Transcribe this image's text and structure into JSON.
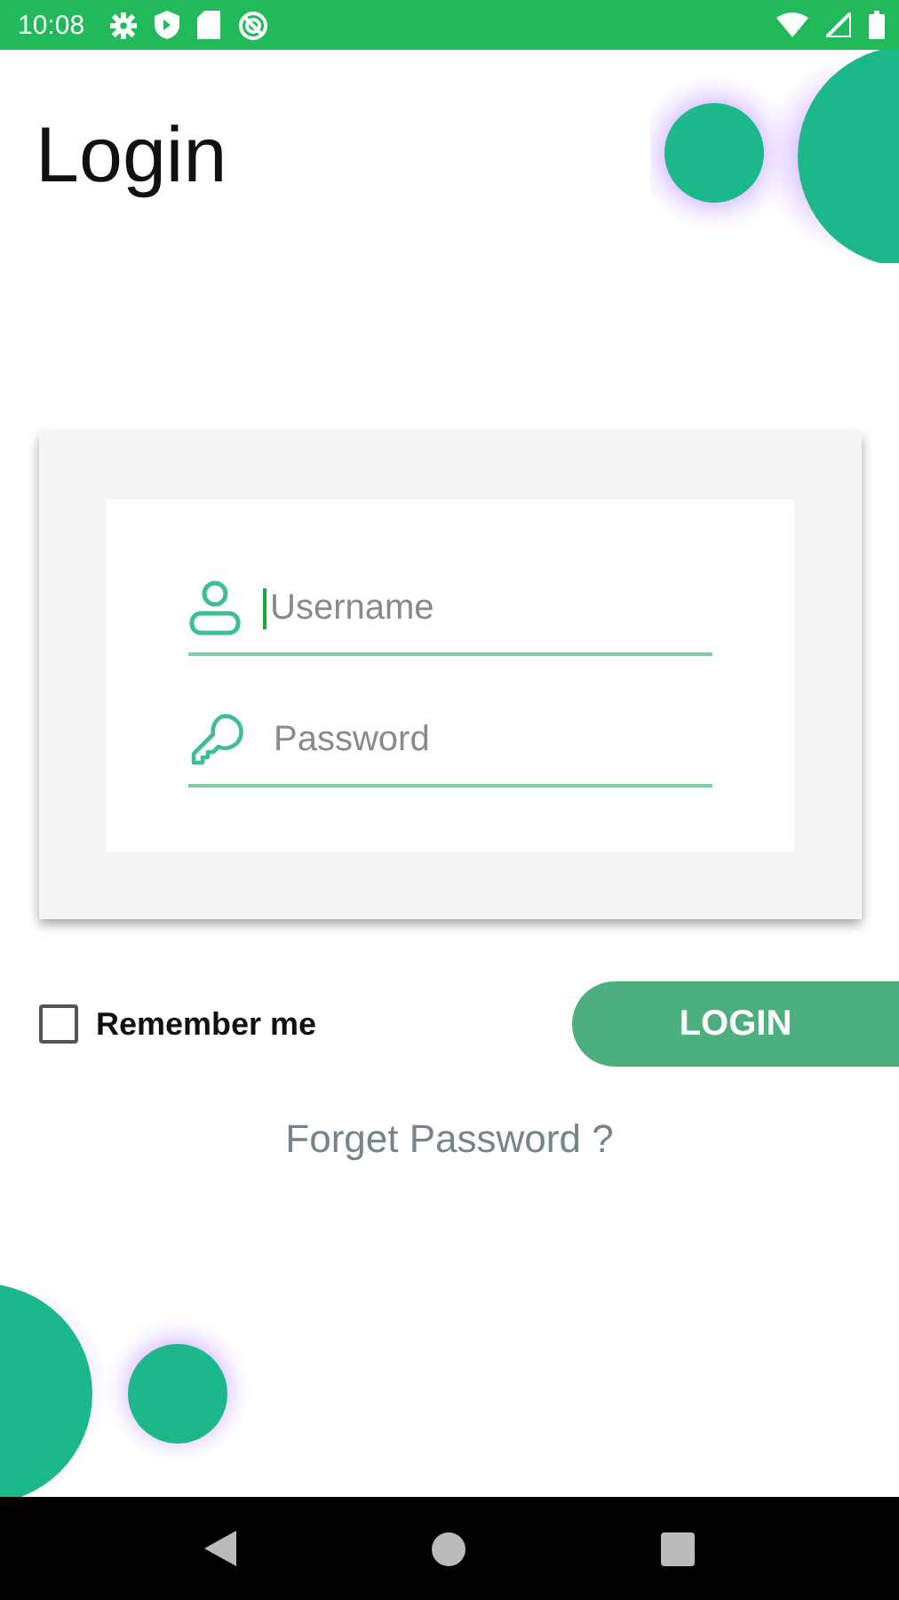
{
  "status_bar": {
    "time": "10:08"
  },
  "title": "Login",
  "fields": [
    {
      "kind": "user",
      "placeholder": "Username",
      "focused": true
    },
    {
      "kind": "key",
      "placeholder": "Password",
      "focused": false
    }
  ],
  "remember": {
    "label": "Remember me",
    "checked": false
  },
  "login_button": "LOGIN",
  "forgot_link": "Forget Password ?"
}
